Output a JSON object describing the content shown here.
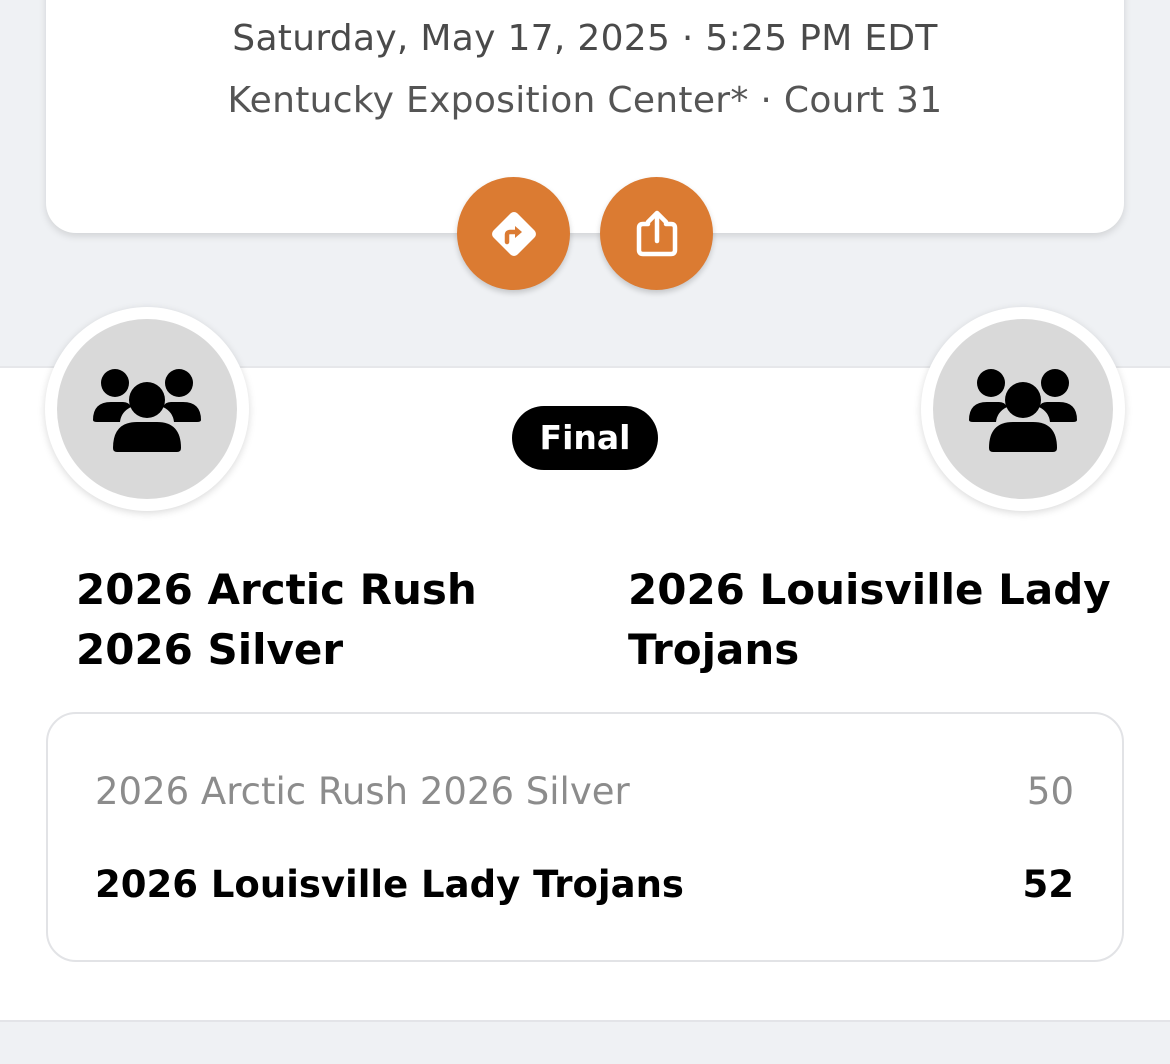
{
  "event": {
    "date_time": "Saturday, May 17, 2025 · 5:25 PM EDT",
    "venue": "Kentucky Exposition Center* · Court 31"
  },
  "actions": {
    "directions_icon": "directions-icon",
    "share_icon": "share-icon",
    "accent_color": "#db7b32"
  },
  "game": {
    "status": "Final",
    "home_team": "2026 Arctic Rush 2026 Silver",
    "away_team": "2026 Louisville Lady Trojans",
    "team_icon": "team-group-icon"
  },
  "scores": [
    {
      "team": "2026 Arctic Rush 2026 Silver",
      "score": "50",
      "winner": false
    },
    {
      "team": "2026 Louisville Lady Trojans",
      "score": "52",
      "winner": true
    }
  ]
}
